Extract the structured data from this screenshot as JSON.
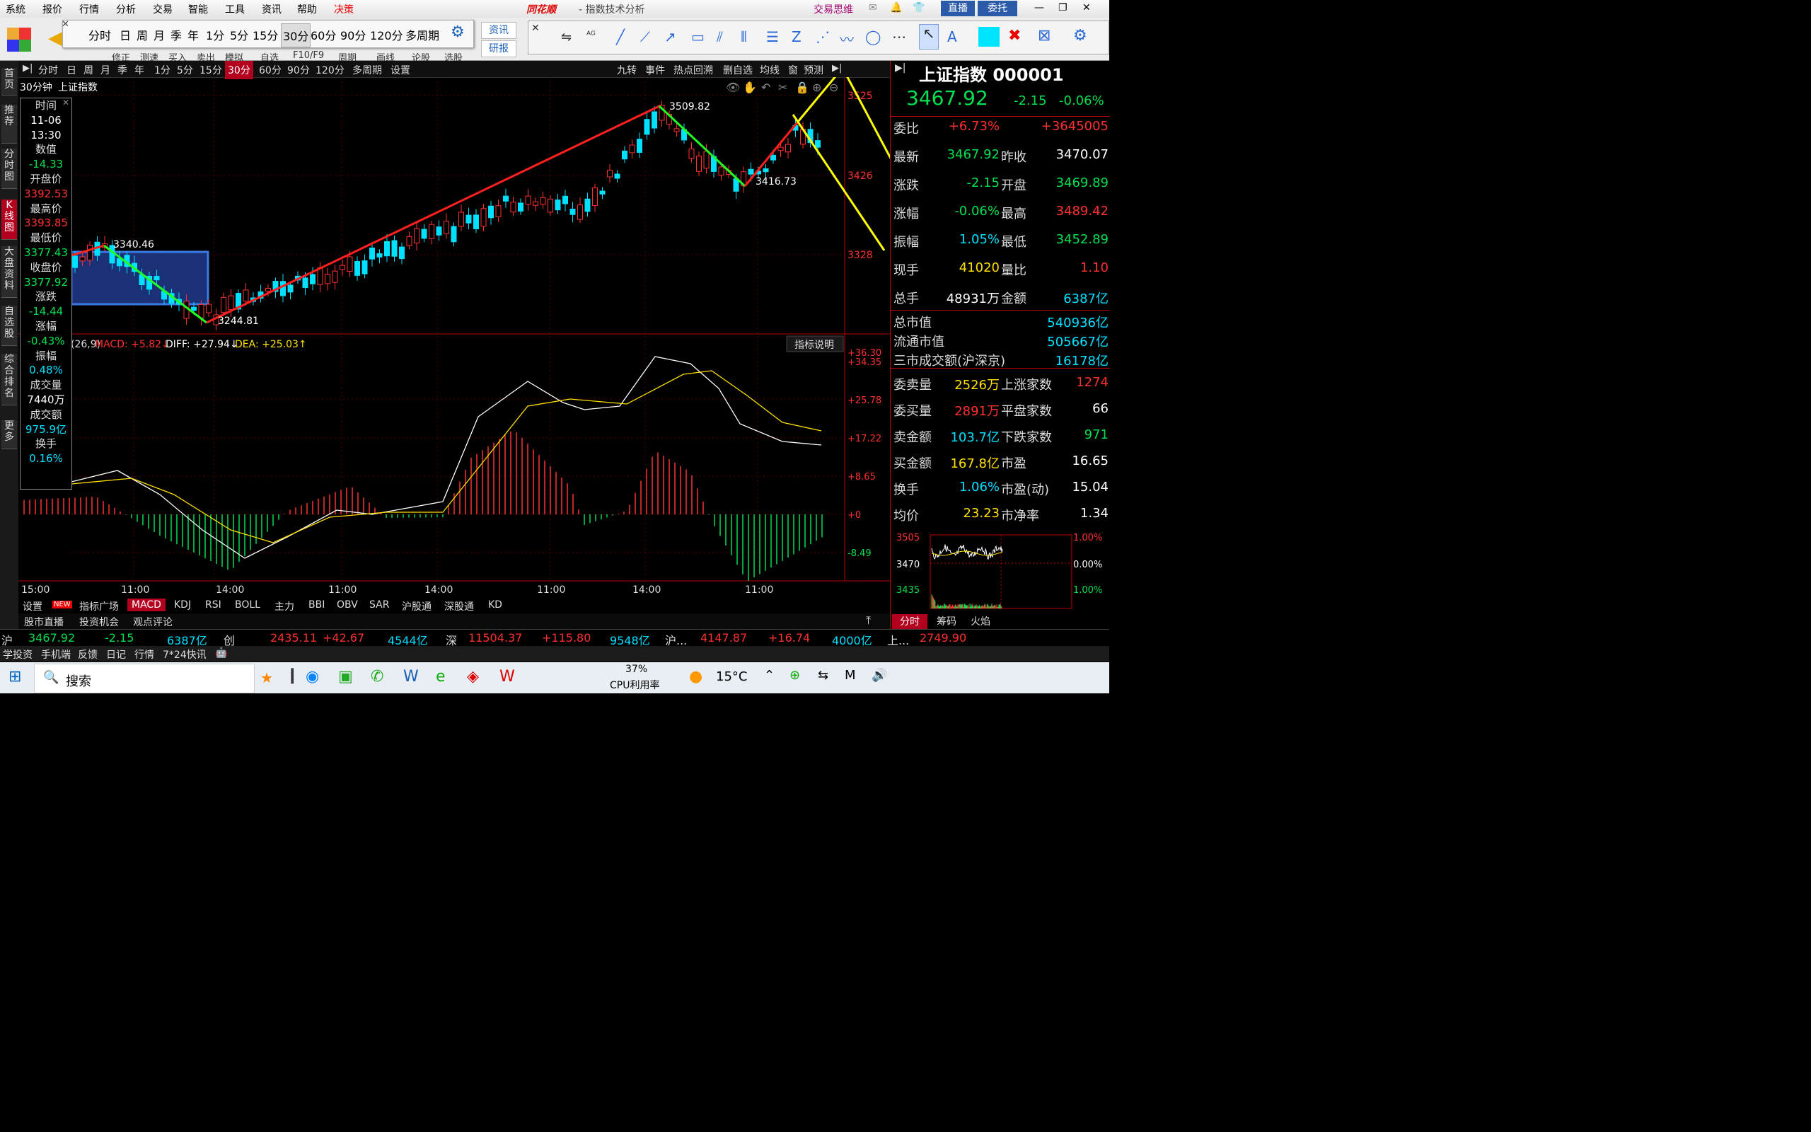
{
  "menu": [
    "系统",
    "报价",
    "行情",
    "分析",
    "交易",
    "智能",
    "工具",
    "资讯",
    "帮助",
    "决策"
  ],
  "app_brand": "同花顺",
  "window_title": "- 指数技术分析",
  "right_menu": [
    "交易思维",
    "直播",
    "委托"
  ],
  "toolbar_labels": [
    "修正",
    "测速",
    "买入",
    "卖出",
    "模拟",
    "自选",
    "F10/F9",
    "周期",
    "画线",
    "论股",
    "选股"
  ],
  "toolbar_right_labels": [
    "资讯",
    "研报"
  ],
  "period_popup": [
    "分时",
    "日",
    "周",
    "月",
    "季",
    "年",
    "1分",
    "5分",
    "15分",
    "30分",
    "60分",
    "90分",
    "120分",
    "多周期"
  ],
  "left_tabs": [
    "首页",
    "推荐",
    "分时图",
    "K线图",
    "大盘资料",
    "自选股",
    "综合排名",
    "更多"
  ],
  "period_bar": [
    "分时",
    "日",
    "周",
    "月",
    "季",
    "年",
    "1分",
    "5分",
    "15分",
    "30分",
    "60分",
    "90分",
    "120分",
    "多周期",
    "设置"
  ],
  "period_bar_right": [
    "九转",
    "事件",
    "热点回溯",
    "删自选",
    "均线",
    "窗",
    "预测"
  ],
  "chart_header": {
    "period": "30分钟",
    "name": "上证指数"
  },
  "info_box": [
    {
      "label": "时间",
      "value": "11-06",
      "color": "#fff"
    },
    {
      "label": "",
      "value": "13:30",
      "color": "#fff"
    },
    {
      "label": "数值",
      "value": "-14.33",
      "color": "#00e050"
    },
    {
      "label": "开盘价",
      "value": "3392.53",
      "color": "#ff3030"
    },
    {
      "label": "最高价",
      "value": "3393.85",
      "color": "#ff3030"
    },
    {
      "label": "最低价",
      "value": "3377.43",
      "color": "#00e050"
    },
    {
      "label": "收盘价",
      "value": "3377.92",
      "color": "#00e050"
    },
    {
      "label": "涨跌",
      "value": "-14.44",
      "color": "#00e050"
    },
    {
      "label": "涨幅",
      "value": "-0.43%",
      "color": "#00e050"
    },
    {
      "label": "振幅",
      "value": "0.48%",
      "color": "#00e0ff"
    },
    {
      "label": "成交量",
      "value": "7440万",
      "color": "#fff"
    },
    {
      "label": "成交额",
      "value": "975.9亿",
      "color": "#00e0ff"
    },
    {
      "label": "换手",
      "value": "0.16%",
      "color": "#00e0ff"
    }
  ],
  "price_axis": [
    "3525",
    "3426",
    "3328"
  ],
  "price_labels": [
    "3340.46",
    "3244.81",
    "3509.82",
    "3416.73"
  ],
  "macd_header": {
    "params": "(26,9)",
    "macd": "MACD: +5.82↓",
    "diff": "DIFF: +27.94↓",
    "dea": "DEA: +25.03↑"
  },
  "indicator_explain": "指标说明",
  "macd_axis": [
    "+36.30",
    "+34.35",
    "+25.78",
    "+17.22",
    "+8.65",
    "+0",
    "-8.49"
  ],
  "time_axis": [
    "15:00",
    "11:00",
    "14:00",
    "11:00",
    "14:00",
    "11:00",
    "14:00",
    "11:00"
  ],
  "indicator_tabs": [
    "设置",
    "NEW",
    "指标广场",
    "MACD",
    "KDJ",
    "RSI",
    "BOLL",
    "主力",
    "BBI",
    "OBV",
    "SAR",
    "沪股通",
    "深股通",
    "KD"
  ],
  "bottom_links": [
    "股市直播",
    "投资机会",
    "观点评论"
  ],
  "right_panel": {
    "title": "上证指数 000001",
    "price": "3467.92",
    "change": "-2.15",
    "pct": "-0.06%",
    "rows": [
      {
        "l1": "委比",
        "v1": "+6.73%",
        "c1": "#ff3030",
        "l2": "",
        "v2": "+3645005",
        "c2": "#ff3030"
      },
      {
        "l1": "最新",
        "v1": "3467.92",
        "c1": "#00e050",
        "l2": "昨收",
        "v2": "3470.07",
        "c2": "#fff"
      },
      {
        "l1": "涨跌",
        "v1": "-2.15",
        "c1": "#00e050",
        "l2": "开盘",
        "v2": "3469.89",
        "c2": "#00e050"
      },
      {
        "l1": "涨幅",
        "v1": "-0.06%",
        "c1": "#00e050",
        "l2": "最高",
        "v2": "3489.42",
        "c2": "#ff3030"
      },
      {
        "l1": "振幅",
        "v1": "1.05%",
        "c1": "#00e0ff",
        "l2": "最低",
        "v2": "3452.89",
        "c2": "#00e050"
      },
      {
        "l1": "现手",
        "v1": "41020",
        "c1": "#ffe000",
        "l2": "量比",
        "v2": "1.10",
        "c2": "#ff3030"
      },
      {
        "l1": "总手",
        "v1": "48931万",
        "c1": "#fff",
        "l2": "金额",
        "v2": "6387亿",
        "c2": "#00e0ff"
      }
    ],
    "mcap": [
      {
        "l": "总市值",
        "v": "540936亿"
      },
      {
        "l": "流通市值",
        "v": "505667亿"
      },
      {
        "l": "三市成交额(沪深京)",
        "v": "16178亿"
      }
    ],
    "rows2": [
      {
        "l1": "委卖量",
        "v1": "2526万",
        "c1": "#ffe000",
        "l2": "上涨家数",
        "v2": "1274",
        "c2": "#ff3030"
      },
      {
        "l1": "委买量",
        "v1": "2891万",
        "c1": "#ff3030",
        "l2": "平盘家数",
        "v2": "66",
        "c2": "#fff"
      },
      {
        "l1": "卖金额",
        "v1": "103.7亿",
        "c1": "#00e0ff",
        "l2": "下跌家数",
        "v2": "971",
        "c2": "#00e050"
      },
      {
        "l1": "买金额",
        "v1": "167.8亿",
        "c1": "#ffe000",
        "l2": "市盈",
        "v2": "16.65",
        "c2": "#fff"
      },
      {
        "l1": "换手",
        "v1": "1.06%",
        "c1": "#00e0ff",
        "l2": "市盈(动)",
        "v2": "15.04",
        "c2": "#fff"
      },
      {
        "l1": "均价",
        "v1": "23.23",
        "c1": "#ffe000",
        "l2": "市净率",
        "v2": "1.34",
        "c2": "#fff"
      }
    ],
    "mini_axis_left": [
      "3505",
      "3470",
      "3435"
    ],
    "mini_axis_right": [
      "1.00%",
      "0.00%",
      "1.00%"
    ],
    "tabs": [
      "分时",
      "筹码",
      "火焰"
    ]
  },
  "ticker": [
    {
      "t": "沪",
      "c": "#ddd"
    },
    {
      "t": "3467.92",
      "c": "#00e050"
    },
    {
      "t": "-2.15",
      "c": "#00e050"
    },
    {
      "t": "6387亿",
      "c": "#00e0ff"
    },
    {
      "t": "创",
      "c": "#ddd"
    },
    {
      "t": "2435.11",
      "c": "#ff3030"
    },
    {
      "t": "+42.67",
      "c": "#ff3030"
    },
    {
      "t": "4544亿",
      "c": "#00e0ff"
    },
    {
      "t": "深",
      "c": "#ddd"
    },
    {
      "t": "11504.37",
      "c": "#ff3030"
    },
    {
      "t": "+115.80",
      "c": "#ff3030"
    },
    {
      "t": "9548亿",
      "c": "#00e0ff"
    },
    {
      "t": "沪...",
      "c": "#ddd"
    },
    {
      "t": "4147.87",
      "c": "#ff3030"
    },
    {
      "t": "+16.74",
      "c": "#ff3030"
    },
    {
      "t": "4000亿",
      "c": "#00e0ff"
    },
    {
      "t": "上...",
      "c": "#ddd"
    },
    {
      "t": "2749.90",
      "c": "#ff3030"
    }
  ],
  "status_row": [
    "学投资",
    "手机端",
    "反馈",
    "日记",
    "行情",
    "7*24快讯"
  ],
  "taskbar": {
    "search": "搜索",
    "cpu": "37%",
    "cpu_label": "CPU利用率",
    "temp": "15°C"
  },
  "colors": {
    "up": "#ff3030",
    "down": "#00e0ff",
    "trend_up": "#ff2020",
    "trend_down": "#20ff20",
    "projection": "#ffff00"
  }
}
